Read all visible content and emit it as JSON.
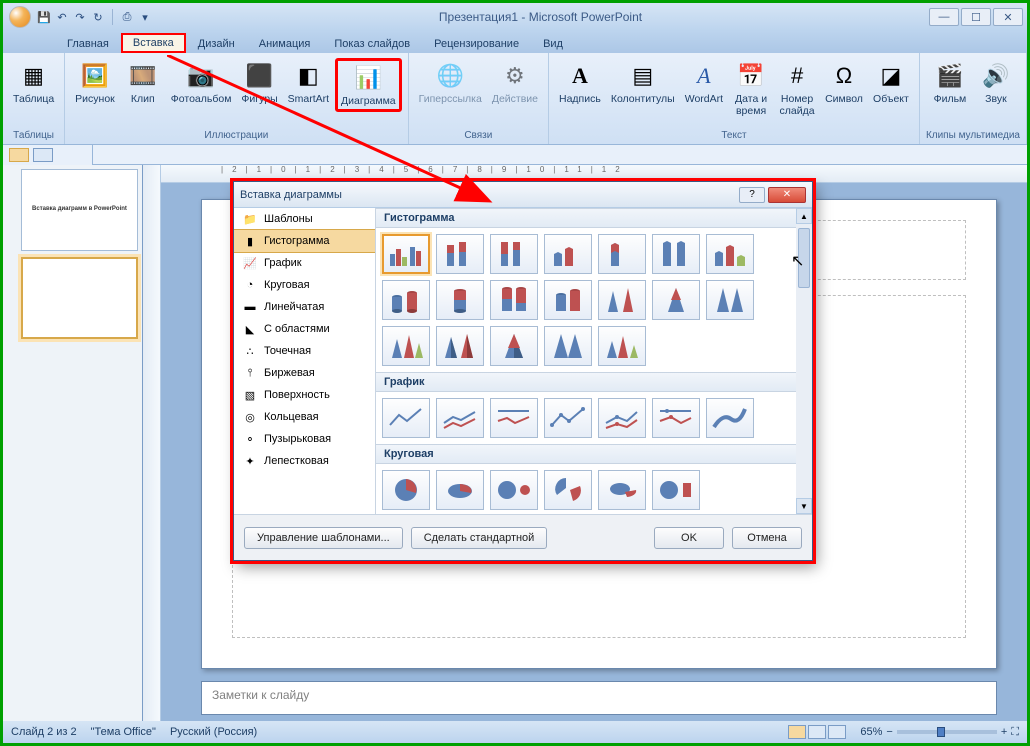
{
  "title": "Презентация1 - Microsoft PowerPoint",
  "tabs": [
    "Главная",
    "Вставка",
    "Дизайн",
    "Анимация",
    "Показ слайдов",
    "Рецензирование",
    "Вид"
  ],
  "ribbon": {
    "groups": {
      "tables": {
        "label": "Таблицы",
        "btns": [
          {
            "label": "Таблица"
          }
        ]
      },
      "illustr": {
        "label": "Иллюстрации",
        "btns": [
          {
            "label": "Рисунок"
          },
          {
            "label": "Клип"
          },
          {
            "label": "Фотоальбом"
          },
          {
            "label": "Фигуры"
          },
          {
            "label": "SmartArt"
          },
          {
            "label": "Диаграмма"
          }
        ]
      },
      "links": {
        "label": "Связи",
        "btns": [
          {
            "label": "Гиперссылка"
          },
          {
            "label": "Действие"
          }
        ]
      },
      "text": {
        "label": "Текст",
        "btns": [
          {
            "label": "Надпись"
          },
          {
            "label": "Колонтитулы"
          },
          {
            "label": "WordArt"
          },
          {
            "label": "Дата и\nвремя"
          },
          {
            "label": "Номер\nслайда"
          },
          {
            "label": "Символ"
          },
          {
            "label": "Объект"
          }
        ]
      },
      "media": {
        "label": "Клипы мультимедиа",
        "btns": [
          {
            "label": "Фильм"
          },
          {
            "label": "Звук"
          }
        ]
      }
    }
  },
  "thumb1_text": "Вставка диаграмм в PowerPoint",
  "notes_placeholder": "Заметки к слайду",
  "status": {
    "slide": "Слайд 2 из 2",
    "theme": "\"Тема Office\"",
    "lang": "Русский (Россия)",
    "zoom": "65%"
  },
  "dialog": {
    "title": "Вставка диаграммы",
    "cats": [
      "Шаблоны",
      "Гистограмма",
      "График",
      "Круговая",
      "Линейчатая",
      "С областями",
      "Точечная",
      "Биржевая",
      "Поверхность",
      "Кольцевая",
      "Пузырьковая",
      "Лепестковая"
    ],
    "sections": [
      "Гистограмма",
      "График",
      "Круговая"
    ],
    "foot": {
      "manage": "Управление шаблонами...",
      "default": "Сделать стандартной",
      "ok": "OK",
      "cancel": "Отмена"
    }
  }
}
